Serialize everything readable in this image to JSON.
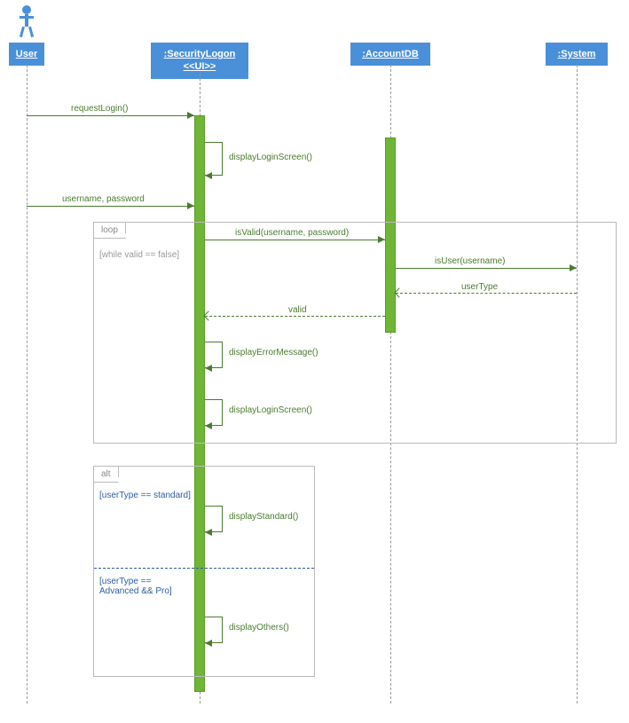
{
  "actors": {
    "user": "User",
    "securityLogon": {
      "name": ":SecurityLogon",
      "stereo": "<<UI>>"
    },
    "accountDB": ":AccountDB",
    "system": ":System"
  },
  "messages": {
    "requestLogin": "requestLogin()",
    "displayLoginScreen": "displayLoginScreen()",
    "usernamePassword": "username, password",
    "isValid": "isValid(username, password)",
    "isUser": "isUser(username)",
    "userType": "userType",
    "valid": "valid",
    "displayErrorMessage": "displayErrorMessage()",
    "displayLoginScreen2": "displayLoginScreen()",
    "displayStandard": "displayStandard()",
    "displayOthers": "displayOthers()"
  },
  "fragments": {
    "loop": {
      "label": "loop",
      "guard": "[while valid == false]"
    },
    "alt": {
      "label": "alt",
      "guard1": "[userType == standard]",
      "guard2": "[userType == Advanced && Pro]"
    }
  }
}
